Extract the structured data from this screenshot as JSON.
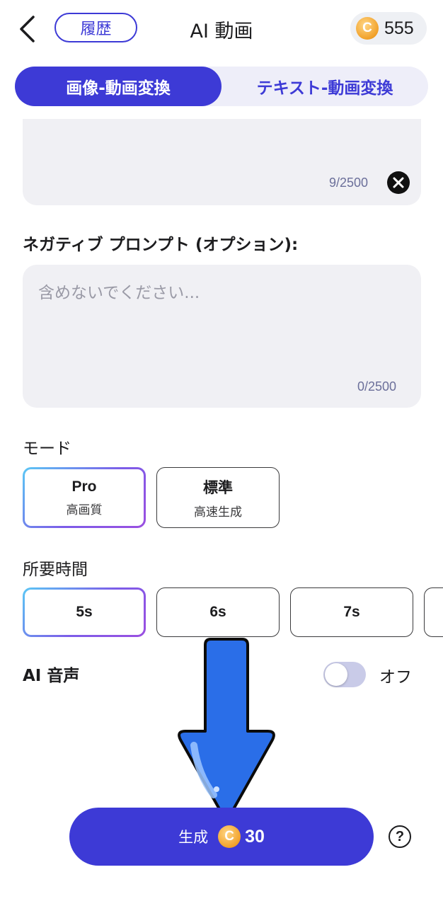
{
  "header": {
    "history_label": "履歴",
    "title": "AI 動画",
    "credits": "555",
    "coin_symbol": "C"
  },
  "tabs": [
    {
      "label": "画像-動画変換",
      "active": true
    },
    {
      "label": "テキスト-動画変換",
      "active": false
    }
  ],
  "prompt": {
    "count": "9/2500"
  },
  "negative_prompt": {
    "label": "ネガティブ プロンプト (オプション):",
    "placeholder": "含めないでください...",
    "count": "0/2500"
  },
  "mode": {
    "label": "モード",
    "options": [
      {
        "title": "Pro",
        "subtitle": "高画質",
        "selected": true
      },
      {
        "title": "標準",
        "subtitle": "高速生成",
        "selected": false
      }
    ]
  },
  "duration": {
    "label": "所要時間",
    "options": [
      "5s",
      "6s",
      "7s"
    ],
    "selected": "5s"
  },
  "ai_voice": {
    "label": "AI 音声",
    "state": "オフ",
    "enabled": false
  },
  "generate": {
    "label": "生成",
    "coin_symbol": "C",
    "cost": "30"
  },
  "help_symbol": "?",
  "colors": {
    "accent": "#3d3ad6",
    "coin": "#f1a12a",
    "arrow": "#2a6ee8"
  }
}
